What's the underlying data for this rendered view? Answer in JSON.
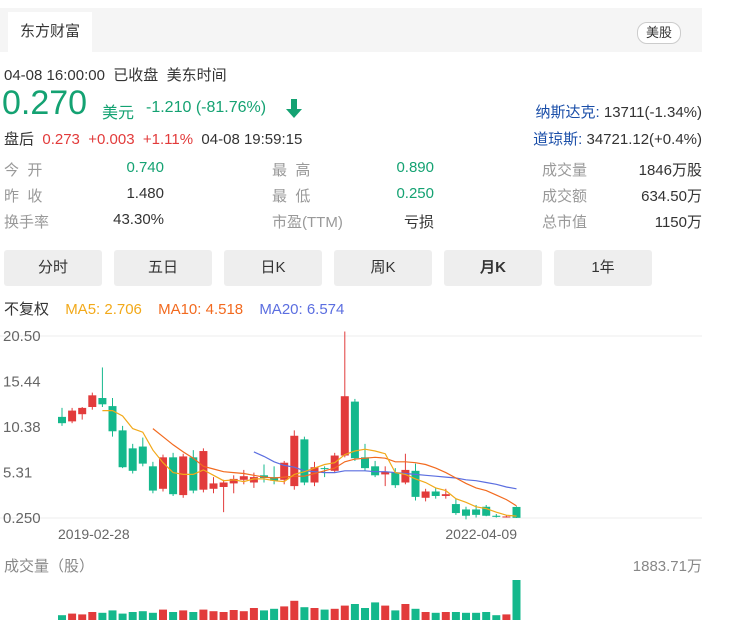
{
  "header": {
    "tab": "东方财富",
    "market_tag": "美股"
  },
  "status": {
    "datetime": "04-08 16:00:00",
    "state": "已收盘",
    "tz": "美东时间"
  },
  "quote": {
    "price": "0.270",
    "currency": "美元",
    "change": "-1.210 (-81.76%)"
  },
  "after_hours": {
    "label": "盘后",
    "price": "0.273",
    "change": "+0.003",
    "pct": "+1.11%",
    "time": "04-08 19:59:15"
  },
  "indices": [
    {
      "name": "纳斯达克:",
      "value": "13711(-1.34%)"
    },
    {
      "name": "道琼斯:",
      "value": "34721.12(+0.4%)"
    }
  ],
  "stats": [
    {
      "label": "今  开",
      "value": "0.740",
      "tone": "green"
    },
    {
      "label": "最  高",
      "value": "0.890",
      "tone": "green"
    },
    {
      "label": "成交量",
      "value": "1846万股",
      "tone": "dark"
    },
    {
      "label": "昨  收",
      "value": "1.480",
      "tone": "dark"
    },
    {
      "label": "最  低",
      "value": "0.250",
      "tone": "green"
    },
    {
      "label": "成交额",
      "value": "634.50万",
      "tone": "dark"
    },
    {
      "label": "换手率",
      "value": "43.30%",
      "tone": "dark"
    },
    {
      "label": "市盈(TTM)",
      "value": "亏损",
      "tone": "dark"
    },
    {
      "label": "总市值",
      "value": "1150万",
      "tone": "dark"
    }
  ],
  "period_tabs": [
    "分时",
    "五日",
    "日K",
    "周K",
    "月K",
    "1年"
  ],
  "active_tab": "月K",
  "ma_legend": {
    "adjust": "不复权",
    "ma5": "MA5: 2.706",
    "ma10": "MA10: 4.518",
    "ma20": "MA20: 6.574",
    "colors": {
      "ma5": "#f2a91a",
      "ma10": "#f26a1f",
      "ma20": "#5b6ee0",
      "up": "#e23b3b",
      "down": "#14b88c"
    }
  },
  "volume_label": "成交量（股）",
  "volume_max_label": "1883.71万",
  "chart_data": {
    "type": "candlestick",
    "y_ticks": [
      "20.50",
      "15.44",
      "10.38",
      "5.31",
      "0.250"
    ],
    "ylim": [
      0.25,
      20.5
    ],
    "x_labels": [
      "2019-02-28",
      "2022-04-09"
    ],
    "candles": [
      [
        11.5,
        12.5,
        10.5,
        10.8
      ],
      [
        11.0,
        12.5,
        10.8,
        12.2
      ],
      [
        11.8,
        12.6,
        11.2,
        12.5
      ],
      [
        12.6,
        14.2,
        12.3,
        13.9
      ],
      [
        13.6,
        17.0,
        12.6,
        12.9
      ],
      [
        12.7,
        13.6,
        9.3,
        9.9
      ],
      [
        10.0,
        10.5,
        5.8,
        5.9
      ],
      [
        8.0,
        8.5,
        5.2,
        5.5
      ],
      [
        8.2,
        9.2,
        6.0,
        6.3
      ],
      [
        6.0,
        6.5,
        3.0,
        3.3
      ],
      [
        3.5,
        7.3,
        3.2,
        7.0
      ],
      [
        7.0,
        7.5,
        2.7,
        2.9
      ],
      [
        2.8,
        7.4,
        2.5,
        7.1
      ],
      [
        7.0,
        7.8,
        3.0,
        3.3
      ],
      [
        3.4,
        8.0,
        3.1,
        7.7
      ],
      [
        3.5,
        4.8,
        3.0,
        4.1
      ],
      [
        3.7,
        4.5,
        0.9,
        4.2
      ],
      [
        4.1,
        5.0,
        3.0,
        4.6
      ],
      [
        4.5,
        5.6,
        4.0,
        4.9
      ],
      [
        4.2,
        5.3,
        3.6,
        4.8
      ],
      [
        5.0,
        6.2,
        4.2,
        4.7
      ],
      [
        4.8,
        6.0,
        4.0,
        4.4
      ],
      [
        4.5,
        6.6,
        4.0,
        6.4
      ],
      [
        3.8,
        10.0,
        3.4,
        9.4
      ],
      [
        9.0,
        9.3,
        3.9,
        4.2
      ],
      [
        4.2,
        6.5,
        3.8,
        5.9
      ],
      [
        5.8,
        6.0,
        4.8,
        5.7
      ],
      [
        5.5,
        7.5,
        5.3,
        7.2
      ],
      [
        7.2,
        21.0,
        7.0,
        13.8
      ],
      [
        13.2,
        13.5,
        6.6,
        6.9
      ],
      [
        7.0,
        8.5,
        5.5,
        5.8
      ],
      [
        6.0,
        6.6,
        4.8,
        5.0
      ],
      [
        5.1,
        6.0,
        3.8,
        5.4
      ],
      [
        5.3,
        5.8,
        3.6,
        3.9
      ],
      [
        4.2,
        7.4,
        4.0,
        5.6
      ],
      [
        5.5,
        6.3,
        2.2,
        2.6
      ],
      [
        2.5,
        3.5,
        2.1,
        3.2
      ],
      [
        3.2,
        3.6,
        2.4,
        2.7
      ],
      [
        2.7,
        3.5,
        2.4,
        2.9
      ],
      [
        1.8,
        2.4,
        0.6,
        0.8
      ],
      [
        1.2,
        1.5,
        0.1,
        0.5
      ],
      [
        1.2,
        1.7,
        0.3,
        0.6
      ],
      [
        1.5,
        1.7,
        0.45,
        0.5
      ],
      [
        0.5,
        0.7,
        0.3,
        0.38
      ],
      [
        0.4,
        0.55,
        0.3,
        0.42
      ],
      [
        1.48,
        1.55,
        0.25,
        0.27
      ]
    ],
    "ma5": [
      null,
      null,
      null,
      null,
      12.2,
      12.2,
      11.6,
      10.2,
      9.8,
      7.8,
      6.4,
      5.3,
      5.1,
      5.1,
      5.6,
      5.0,
      4.4,
      4.5,
      4.3,
      4.6,
      4.6,
      4.4,
      4.3,
      5.1,
      5.4,
      5.8,
      6.2,
      6.4,
      7.3,
      7.7,
      7.9,
      7.7,
      7.4,
      5.3,
      5.1,
      4.6,
      4.2,
      3.6,
      3.3,
      2.4,
      2.0,
      1.5,
      1.3,
      0.9,
      0.56,
      0.46
    ],
    "ma10": [
      null,
      null,
      null,
      null,
      null,
      null,
      null,
      null,
      null,
      10.2,
      9.3,
      8.4,
      7.6,
      6.9,
      6.0,
      5.7,
      5.4,
      5.3,
      5.2,
      5.0,
      4.8,
      4.7,
      4.8,
      4.9,
      4.9,
      5.2,
      5.5,
      5.8,
      6.5,
      6.8,
      6.9,
      7.0,
      6.9,
      6.5,
      6.5,
      6.4,
      6.2,
      5.8,
      5.3,
      4.7,
      4.1,
      3.6,
      3.3,
      2.8,
      2.3,
      1.6
    ],
    "ma20": [
      null,
      null,
      null,
      null,
      null,
      null,
      null,
      null,
      null,
      null,
      null,
      null,
      null,
      null,
      null,
      null,
      null,
      null,
      null,
      7.6,
      7.1,
      6.5,
      6.1,
      5.9,
      5.5,
      5.4,
      5.3,
      5.3,
      5.5,
      5.5,
      5.5,
      5.4,
      5.4,
      5.3,
      5.2,
      5.1,
      5.0,
      4.9,
      4.8,
      4.7,
      4.5,
      4.4,
      4.2,
      4.0,
      3.7,
      3.5
    ],
    "volumes": [
      0.12,
      0.16,
      0.14,
      0.2,
      0.18,
      0.24,
      0.16,
      0.2,
      0.22,
      0.18,
      0.26,
      0.2,
      0.24,
      0.2,
      0.26,
      0.22,
      0.2,
      0.25,
      0.22,
      0.3,
      0.24,
      0.28,
      0.34,
      0.48,
      0.32,
      0.3,
      0.26,
      0.28,
      0.36,
      0.4,
      0.3,
      0.44,
      0.36,
      0.24,
      0.4,
      0.28,
      0.2,
      0.18,
      0.2,
      0.2,
      0.18,
      0.18,
      0.2,
      0.12,
      0.14,
      1.0
    ]
  }
}
